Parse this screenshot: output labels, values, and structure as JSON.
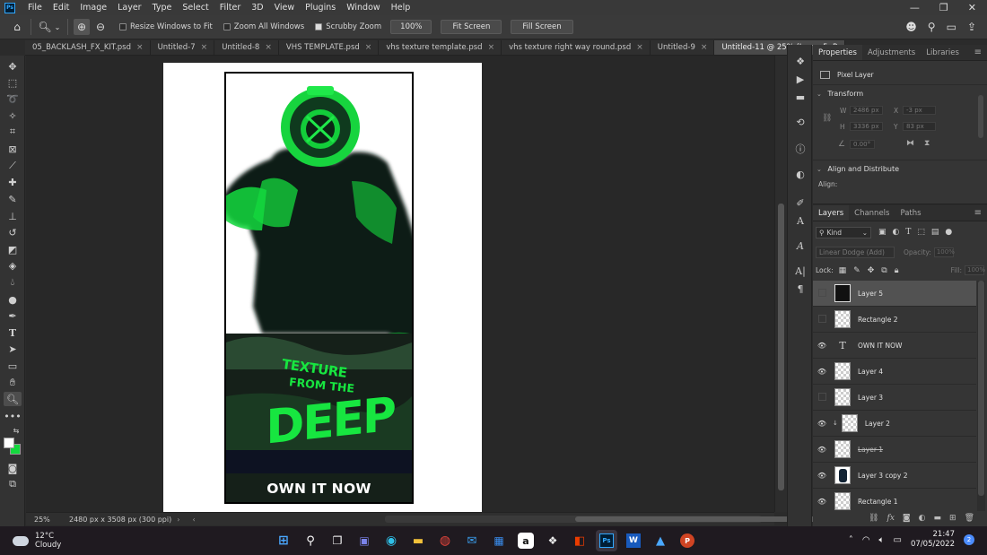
{
  "menubar": {
    "items": [
      "File",
      "Edit",
      "Image",
      "Layer",
      "Type",
      "Select",
      "Filter",
      "3D",
      "View",
      "Plugins",
      "Window",
      "Help"
    ]
  },
  "options": {
    "resize_windows": "Resize Windows to Fit",
    "zoom_all": "Zoom All Windows",
    "scrubby_zoom": "Scrubby Zoom",
    "zoom_value": "100%",
    "fit_screen": "Fit Screen",
    "fill_screen": "Fill Screen"
  },
  "tabs": [
    {
      "label": "05_BACKLASH_FX_KIT.psd",
      "active": false
    },
    {
      "label": "Untitled-7",
      "active": false
    },
    {
      "label": "Untitled-8",
      "active": false
    },
    {
      "label": "VHS TEMPLATE.psd",
      "active": false
    },
    {
      "label": "vhs texture template.psd",
      "active": false
    },
    {
      "label": "vhs texture right way round.psd",
      "active": false
    },
    {
      "label": "Untitled-9",
      "active": false
    },
    {
      "label": "Untitled-11 @ 25% (Layer 5, R",
      "active": true
    }
  ],
  "poster": {
    "title": "OWN IT NOW",
    "art_text_line1": "TEXTURE",
    "art_text_line2": "FROM THE",
    "art_text_line3": "DEEP",
    "accent_color": "#14e83f",
    "bg_color": "#111828"
  },
  "status": {
    "zoom": "25%",
    "doc_info": "2480 px x 3508 px (300 ppi)"
  },
  "properties": {
    "tabs": [
      "Properties",
      "Adjustments",
      "Libraries"
    ],
    "layer_type": "Pixel Layer",
    "transform_title": "Transform",
    "w_label": "W",
    "w_value": "2486 px",
    "h_label": "H",
    "h_value": "3336 px",
    "x_label": "X",
    "x_value": "-3 px",
    "y_label": "Y",
    "y_value": "83 px",
    "angle_value": "0.00°",
    "align_title": "Align and Distribute",
    "align_label": "Align:"
  },
  "layers_panel": {
    "tabs": [
      "Layers",
      "Channels",
      "Paths"
    ],
    "kind_label": "Kind",
    "blend_mode": "Linear Dodge (Add)",
    "opacity_label": "Opacity:",
    "opacity_value": "100%",
    "lock_label": "Lock:",
    "fill_label": "Fill:",
    "fill_value": "100%",
    "layers": [
      {
        "name": "Layer 5",
        "visible": false,
        "thumb": "dark",
        "selected": true,
        "strike": false,
        "clip": false
      },
      {
        "name": "Rectangle 2",
        "visible": false,
        "thumb": "checker",
        "selected": false,
        "strike": false,
        "clip": false
      },
      {
        "name": "OWN IT NOW",
        "visible": true,
        "thumb": "text",
        "selected": false,
        "strike": false,
        "clip": false
      },
      {
        "name": "Layer 4",
        "visible": true,
        "thumb": "checker",
        "selected": false,
        "strike": false,
        "clip": false
      },
      {
        "name": "Layer 3",
        "visible": false,
        "thumb": "checker",
        "selected": false,
        "strike": false,
        "clip": false
      },
      {
        "name": "Layer 2",
        "visible": true,
        "thumb": "checker",
        "selected": false,
        "strike": false,
        "clip": true
      },
      {
        "name": "Layer 1",
        "visible": true,
        "thumb": "checker",
        "selected": false,
        "strike": true,
        "clip": false
      },
      {
        "name": "Layer 3 copy 2",
        "visible": true,
        "thumb": "diver",
        "selected": false,
        "strike": false,
        "clip": false
      },
      {
        "name": "Rectangle 1",
        "visible": true,
        "thumb": "checker",
        "selected": false,
        "strike": false,
        "clip": false
      }
    ]
  },
  "taskbar": {
    "temperature": "12°C",
    "weather": "Cloudy",
    "time": "21:47",
    "date": "07/05/2022",
    "notifications": "2"
  }
}
